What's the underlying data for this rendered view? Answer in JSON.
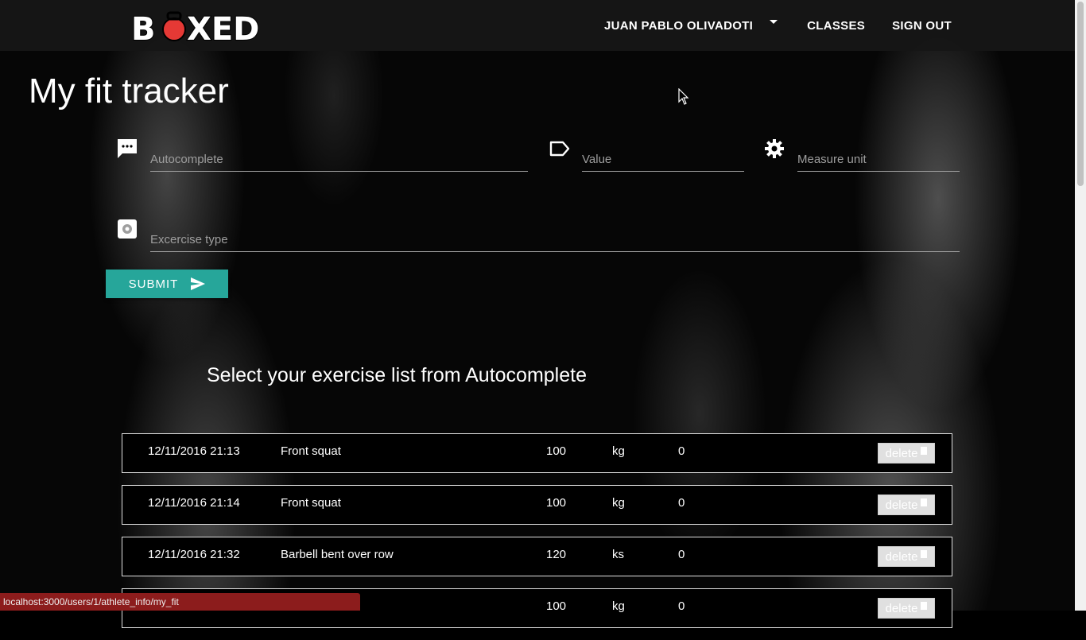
{
  "brand": {
    "logo_text": "BOXED",
    "accent_color": "#e53935"
  },
  "nav": {
    "user_label": "JUAN PABLO OLIVADOTI",
    "classes_label": "CLASSES",
    "signout_label": "SIGN OUT"
  },
  "page": {
    "title": "My fit tracker"
  },
  "form": {
    "autocomplete_placeholder": "Autocomplete",
    "value_placeholder": "Value",
    "measure_unit_placeholder": "Measure unit",
    "exercise_type_placeholder": "Excercise type",
    "submit_label": "SUBMIT",
    "submit_color": "#26a69a",
    "icons": {
      "autocomplete": "message-icon",
      "value": "label-icon",
      "measure_unit": "settings-icon",
      "exercise_type": "settings-applications-icon",
      "submit": "send-icon"
    }
  },
  "list": {
    "heading": "Select your exercise list from Autocomplete",
    "delete_label": "delete",
    "rows": [
      {
        "date": "12/11/2016 21:13",
        "exercise": "Front squat",
        "value": "100",
        "unit": "kg",
        "extra": "0"
      },
      {
        "date": "12/11/2016 21:14",
        "exercise": "Front squat",
        "value": "100",
        "unit": "kg",
        "extra": "0"
      },
      {
        "date": "12/11/2016 21:32",
        "exercise": "Barbell bent over row",
        "value": "120",
        "unit": "ks",
        "extra": "0"
      },
      {
        "date": "",
        "exercise": "",
        "value": "100",
        "unit": "kg",
        "extra": "0"
      }
    ]
  },
  "statusbar": {
    "url": "localhost:3000/users/1/athlete_info/my_fit"
  }
}
